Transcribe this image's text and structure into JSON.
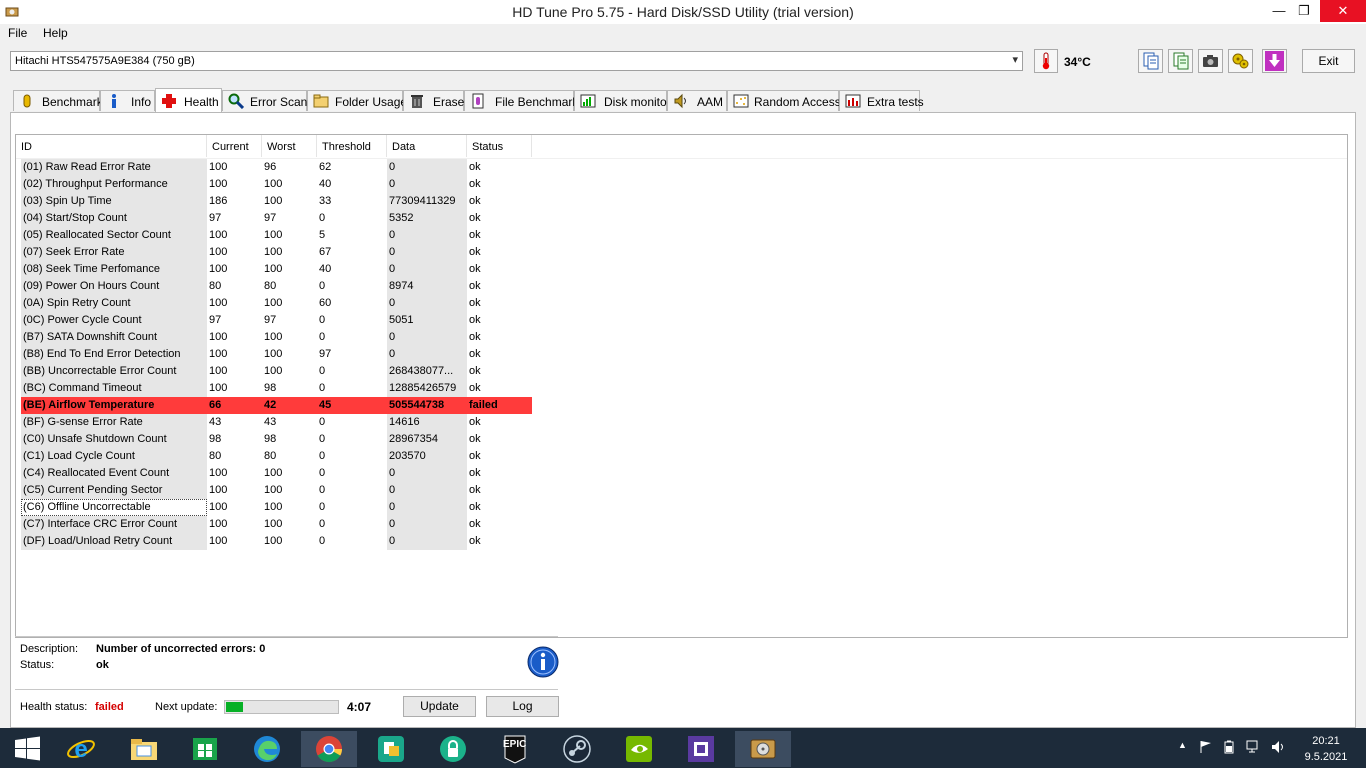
{
  "window": {
    "title": "HD Tune Pro 5.75 - Hard Disk/SSD Utility (trial version)",
    "minimize": "—",
    "maximize": "❐",
    "close": "✕"
  },
  "menu": {
    "file": "File",
    "help": "Help"
  },
  "toolbar": {
    "drive": "Hitachi HTS547575A9E384 (750 gB)",
    "temperature": "34°C",
    "exit": "Exit",
    "icons": [
      "copy-text-icon",
      "copy-info-icon",
      "screenshot-icon",
      "options-icon",
      "save-icon"
    ]
  },
  "tabs": [
    {
      "label": "Benchmark",
      "icon": "benchmark-icon"
    },
    {
      "label": "Info",
      "icon": "info-icon"
    },
    {
      "label": "Health",
      "icon": "health-cross-icon",
      "active": true
    },
    {
      "label": "Error Scan",
      "icon": "magnifier-icon"
    },
    {
      "label": "Folder Usage",
      "icon": "folder-icon"
    },
    {
      "label": "Erase",
      "icon": "trash-icon"
    },
    {
      "label": "File Benchmark",
      "icon": "file-benchmark-icon"
    },
    {
      "label": "Disk monitor",
      "icon": "disk-monitor-icon"
    },
    {
      "label": "AAM",
      "icon": "speaker-icon"
    },
    {
      "label": "Random Access",
      "icon": "random-access-icon"
    },
    {
      "label": "Extra tests",
      "icon": "extra-tests-icon"
    }
  ],
  "smart": {
    "columns": [
      "ID",
      "Current",
      "Worst",
      "Threshold",
      "Data",
      "Status"
    ],
    "rows": [
      {
        "id": "(01) Raw Read Error Rate",
        "current": "100",
        "worst": "96",
        "threshold": "62",
        "data": "0",
        "status": "ok"
      },
      {
        "id": "(02) Throughput Performance",
        "current": "100",
        "worst": "100",
        "threshold": "40",
        "data": "0",
        "status": "ok"
      },
      {
        "id": "(03) Spin Up Time",
        "current": "186",
        "worst": "100",
        "threshold": "33",
        "data": "77309411329",
        "status": "ok"
      },
      {
        "id": "(04) Start/Stop Count",
        "current": "97",
        "worst": "97",
        "threshold": "0",
        "data": "5352",
        "status": "ok"
      },
      {
        "id": "(05) Reallocated Sector Count",
        "current": "100",
        "worst": "100",
        "threshold": "5",
        "data": "0",
        "status": "ok"
      },
      {
        "id": "(07) Seek Error Rate",
        "current": "100",
        "worst": "100",
        "threshold": "67",
        "data": "0",
        "status": "ok"
      },
      {
        "id": "(08) Seek Time Perfomance",
        "current": "100",
        "worst": "100",
        "threshold": "40",
        "data": "0",
        "status": "ok"
      },
      {
        "id": "(09) Power On Hours Count",
        "current": "80",
        "worst": "80",
        "threshold": "0",
        "data": "8974",
        "status": "ok"
      },
      {
        "id": "(0A) Spin Retry Count",
        "current": "100",
        "worst": "100",
        "threshold": "60",
        "data": "0",
        "status": "ok"
      },
      {
        "id": "(0C) Power Cycle Count",
        "current": "97",
        "worst": "97",
        "threshold": "0",
        "data": "5051",
        "status": "ok"
      },
      {
        "id": "(B7) SATA Downshift Count",
        "current": "100",
        "worst": "100",
        "threshold": "0",
        "data": "0",
        "status": "ok"
      },
      {
        "id": "(B8) End To End Error Detection",
        "current": "100",
        "worst": "100",
        "threshold": "97",
        "data": "0",
        "status": "ok"
      },
      {
        "id": "(BB) Uncorrectable Error Count",
        "current": "100",
        "worst": "100",
        "threshold": "0",
        "data": "268438077...",
        "status": "ok"
      },
      {
        "id": "(BC) Command Timeout",
        "current": "100",
        "worst": "98",
        "threshold": "0",
        "data": "12885426579",
        "status": "ok"
      },
      {
        "id": "(BE) Airflow Temperature",
        "current": "66",
        "worst": "42",
        "threshold": "45",
        "data": "505544738",
        "status": "failed",
        "failed": true
      },
      {
        "id": "(BF) G-sense Error Rate",
        "current": "43",
        "worst": "43",
        "threshold": "0",
        "data": "14616",
        "status": "ok"
      },
      {
        "id": "(C0) Unsafe Shutdown Count",
        "current": "98",
        "worst": "98",
        "threshold": "0",
        "data": "28967354",
        "status": "ok"
      },
      {
        "id": "(C1) Load Cycle Count",
        "current": "80",
        "worst": "80",
        "threshold": "0",
        "data": "203570",
        "status": "ok"
      },
      {
        "id": "(C4) Reallocated Event Count",
        "current": "100",
        "worst": "100",
        "threshold": "0",
        "data": "0",
        "status": "ok"
      },
      {
        "id": "(C5) Current Pending Sector",
        "current": "100",
        "worst": "100",
        "threshold": "0",
        "data": "0",
        "status": "ok"
      },
      {
        "id": "(C6) Offline Uncorrectable",
        "current": "100",
        "worst": "100",
        "threshold": "0",
        "data": "0",
        "status": "ok",
        "focused": true
      },
      {
        "id": "(C7) Interface CRC Error Count",
        "current": "100",
        "worst": "100",
        "threshold": "0",
        "data": "0",
        "status": "ok"
      },
      {
        "id": "(DF) Load/Unload Retry Count",
        "current": "100",
        "worst": "100",
        "threshold": "0",
        "data": "0",
        "status": "ok"
      }
    ]
  },
  "details": {
    "description_label": "Description:",
    "description_value": "Number of uncorrected errors: 0",
    "status_label": "Status:",
    "status_value": "ok"
  },
  "footer": {
    "health_label": "Health status:",
    "health_value": "failed",
    "next_update_label": "Next update:",
    "progress_fraction": 0.15,
    "countdown": "4:07",
    "update_button": "Update",
    "log_button": "Log"
  },
  "colors": {
    "failed": "#ff3b3b",
    "failed_text": "#d40000",
    "progress": "#06b025",
    "close": "#e81123"
  },
  "taskbar": {
    "apps": [
      "windows-start-icon",
      "internet-explorer-icon",
      "file-explorer-icon",
      "store-icon",
      "edge-icon",
      "chrome-icon",
      "app-icon",
      "vpn-icon",
      "epic-games-icon",
      "steam-icon",
      "nvidia-icon",
      "cpu-z-icon",
      "hd-tune-icon"
    ],
    "epic_label": "EPIC",
    "time": "20:21",
    "date": "9.5.2021"
  }
}
